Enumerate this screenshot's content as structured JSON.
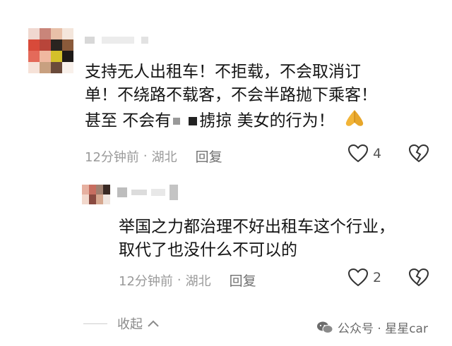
{
  "comment": {
    "text_line1": "支持无人出租车！不拒载，不会取消订",
    "text_line2": "单！不绕路不载客，不会半路抛下乘客！",
    "text_line3_a": "甚至 不会有",
    "text_line3_b": "掳掠 美女的行为！",
    "emoji_icon": "praying-hands-emoji",
    "time": "12分钟前",
    "location": "湖北",
    "reply_label": "回复",
    "like_count": "4"
  },
  "reply": {
    "text_line1": "举国之力都治理不好出租车这个行业，",
    "text_line2": "取代了也没什么不可以的",
    "time": "12分钟前",
    "location": "湖北",
    "reply_label": "回复",
    "like_count": "2"
  },
  "collapse_label": "收起",
  "watermark": {
    "text": "公众号 · 星星car",
    "icon": "wechat-icon"
  },
  "colors": {
    "text": "#141414",
    "meta": "#9a9a9a",
    "watermark_icon": "#6b6b6b"
  }
}
